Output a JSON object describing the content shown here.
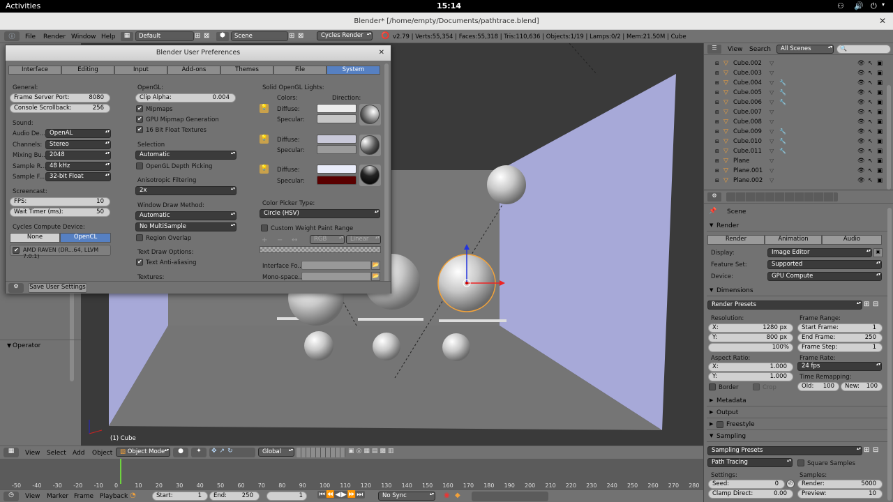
{
  "system": {
    "activities": "Activities",
    "clock": "15:14"
  },
  "window": {
    "title": "Blender* [/home/empty/Documents/pathtrace.blend]"
  },
  "header": {
    "menu": [
      "File",
      "Render",
      "Window",
      "Help"
    ],
    "layout": "Default",
    "scene": "Scene",
    "engine": "Cycles Render",
    "stats": "v2.79 | Verts:55,354 | Faces:55,318 | Tris:110,636 | Objects:1/19 | Lamps:0/2 | Mem:21.50M | Cube"
  },
  "prefs": {
    "title": "Blender User Preferences",
    "tabs": [
      "Interface",
      "Editing",
      "Input",
      "Add-ons",
      "Themes",
      "File",
      "System"
    ],
    "general": {
      "heading": "General:",
      "frame_server_label": "Frame Server Port:",
      "frame_server": "8080",
      "console_label": "Console Scrollback:",
      "console": "256"
    },
    "sound": {
      "heading": "Sound:",
      "rows": [
        {
          "label": "Audio De...",
          "value": "OpenAL"
        },
        {
          "label": "Channels:",
          "value": "Stereo"
        },
        {
          "label": "Mixing Bu...",
          "value": "2048"
        },
        {
          "label": "Sample R...",
          "value": "48 kHz"
        },
        {
          "label": "Sample F...",
          "value": "32-bit Float"
        }
      ]
    },
    "screencast": {
      "heading": "Screencast:",
      "fps_label": "FPS:",
      "fps": "10",
      "wait_label": "Wait Timer (ms):",
      "wait": "50"
    },
    "compute": {
      "heading": "Cycles Compute Device:",
      "none": "None",
      "opencl": "OpenCL",
      "device": "AMD RAVEN (DR...64, LLVM 7.0.1)"
    },
    "opengl": {
      "heading": "OpenGL:",
      "clip_label": "Clip Alpha:",
      "clip": "0.004",
      "mipmaps": "Mipmaps",
      "gpu_mipmap": "GPU Mipmap Generation",
      "float_tex": "16 Bit Float Textures"
    },
    "selection": {
      "heading": "Selection",
      "value": "Automatic",
      "depth": "OpenGL Depth Picking"
    },
    "aniso": {
      "heading": "Anisotropic Filtering",
      "value": "2x"
    },
    "draw": {
      "heading": "Window Draw Method:",
      "value": "Automatic",
      "multisample": "No MultiSample",
      "overlap": "Region Overlap"
    },
    "text": {
      "heading": "Text Draw Options:",
      "aa": "Text Anti-aliasing",
      "textures": "Textures:"
    },
    "lights": {
      "heading": "Solid OpenGL Lights:",
      "colors": "Colors:",
      "direction": "Direction:",
      "diffuse": "Diffuse:",
      "specular": "Specular:",
      "diffuse_colors": [
        "#ececec",
        "#c9c9d9",
        "#e9ecf9"
      ],
      "specular_colors": [
        "#c6c6c6",
        "#9b9b9b",
        "#5a0000"
      ]
    },
    "picker": {
      "heading": "Color Picker Type:",
      "value": "Circle (HSV)",
      "custom_weight": "Custom Weight Paint Range",
      "rgb": "RGB",
      "linear": "Linear"
    },
    "fonts": {
      "interface": "Interface Fo...",
      "mono": "Mono-space..."
    },
    "save": "Save User Settings"
  },
  "outliner": {
    "view": "View",
    "search": "Search",
    "filter": "All Scenes",
    "items": [
      "Cube.002",
      "Cube.003",
      "Cube.004",
      "Cube.005",
      "Cube.006",
      "Cube.007",
      "Cube.008",
      "Cube.009",
      "Cube.010",
      "Cube.011",
      "Plane",
      "Plane.001",
      "Plane.002"
    ]
  },
  "properties": {
    "scene": "Scene",
    "render_panel": "Render",
    "render_btn": "Render",
    "animation_btn": "Animation",
    "audio_btn": "Audio",
    "display_label": "Display:",
    "display": "Image Editor",
    "feature_label": "Feature Set:",
    "feature": "Supported",
    "device_label": "Device:",
    "device": "GPU Compute",
    "dimensions": "Dimensions",
    "presets": "Render Presets",
    "resolution": "Resolution:",
    "res_x_label": "X:",
    "res_x": "1280 px",
    "res_y_label": "Y:",
    "res_y": "800 px",
    "res_pct": "100%",
    "frame_range": "Frame Range:",
    "start_label": "Start Frame:",
    "start": "1",
    "end_label": "End Frame:",
    "end": "250",
    "step_label": "Frame Step:",
    "step": "1",
    "aspect": "Aspect Ratio:",
    "asp_x": "1.000",
    "asp_y": "1.000",
    "frame_rate": "Frame Rate:",
    "fps": "24 fps",
    "border": "Border",
    "crop": "Crop",
    "remap": "Time Remapping:",
    "old_label": "Old:",
    "old": "100",
    "new_label": "New:",
    "new": "100",
    "metadata": "Metadata",
    "output": "Output",
    "freestyle": "Freestyle",
    "sampling": "Sampling",
    "sampling_presets": "Sampling Presets",
    "integrator": "Path Tracing",
    "square": "Square Samples",
    "settings": "Settings:",
    "samples": "Samples:",
    "seed_label": "Seed:",
    "seed": "0",
    "clamp_label": "Clamp Direct:",
    "clamp": "0.00",
    "render_s_label": "Render:",
    "render_s": "5000",
    "preview_label": "Preview:",
    "preview": "10"
  },
  "tool": {
    "operator": "Operator"
  },
  "viewport": {
    "object_label": "(1) Cube"
  },
  "view3d_header": {
    "view": "View",
    "select": "Select",
    "add": "Add",
    "object": "Object",
    "mode": "Object Mode",
    "orientation": "Global"
  },
  "timeline": {
    "ticks": [
      "-50",
      "-40",
      "-30",
      "-20",
      "-10",
      "0",
      "10",
      "20",
      "30",
      "40",
      "50",
      "60",
      "70",
      "80",
      "90",
      "100",
      "110",
      "120",
      "130",
      "140",
      "150",
      "160",
      "170",
      "180",
      "190",
      "200",
      "210",
      "220",
      "230",
      "240",
      "250",
      "260",
      "270",
      "280"
    ],
    "view": "View",
    "marker": "Marker",
    "frame": "Frame",
    "playback": "Playback",
    "start_label": "Start:",
    "start": "1",
    "end_label": "End:",
    "end": "250",
    "current": "1",
    "sync": "No Sync"
  }
}
